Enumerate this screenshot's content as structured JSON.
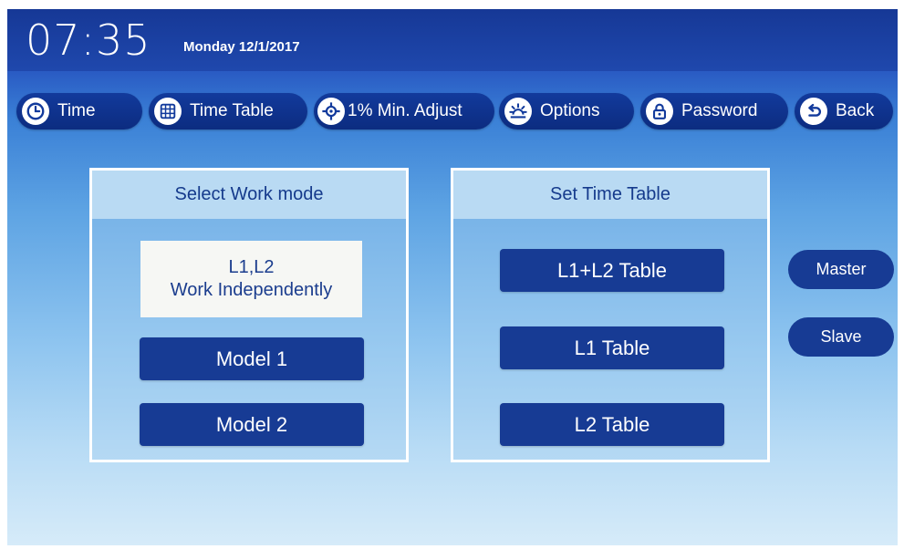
{
  "header": {
    "time": "07:35",
    "date": "Monday 12/1/2017"
  },
  "nav": [
    {
      "label": "Time",
      "icon": "clock-icon"
    },
    {
      "label": "Time Table",
      "icon": "table-grid-icon"
    },
    {
      "label": "1% Min. Adjust",
      "icon": "adjust-target-icon"
    },
    {
      "label": "Options",
      "icon": "sun-options-icon"
    },
    {
      "label": "Password",
      "icon": "lock-icon"
    },
    {
      "label": "Back",
      "icon": "back-arrow-icon"
    }
  ],
  "work_mode": {
    "title": "Select Work mode",
    "selected_line1": "L1,L2",
    "selected_line2": "Work Independently",
    "model1": "Model 1",
    "model2": "Model 2"
  },
  "time_table": {
    "title": "Set Time Table",
    "l1l2": "L1+L2 Table",
    "l1": "L1 Table",
    "l2": "L2 Table"
  },
  "role": {
    "master": "Master",
    "slave": "Slave"
  },
  "colors": {
    "button_navy": "#173b94",
    "header_blue": "#163896",
    "panel_head": "#b9daf3"
  }
}
